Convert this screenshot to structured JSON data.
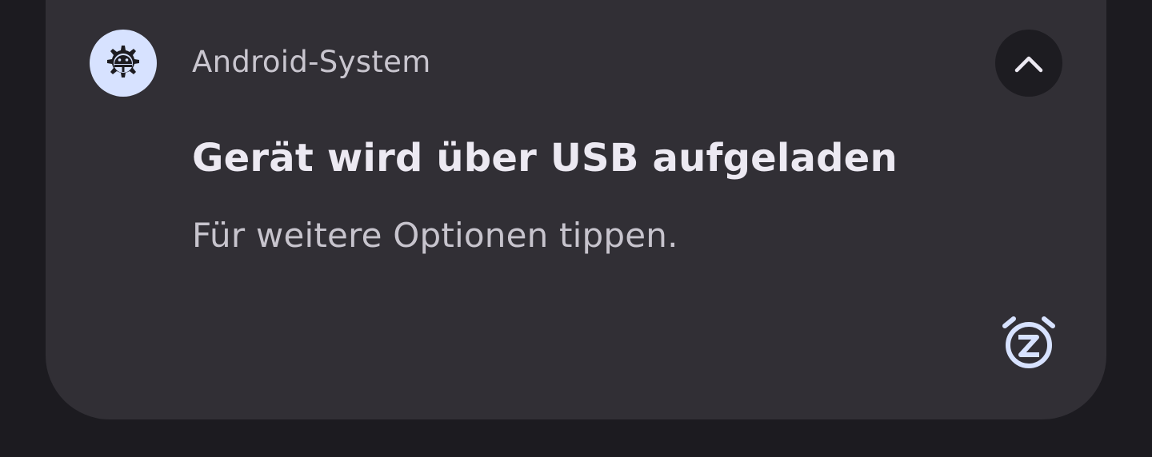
{
  "notification": {
    "app_name": "Android-System",
    "title": "Gerät wird über USB aufgeladen",
    "text": "Für weitere Optionen tippen.",
    "app_icon": "android-system-gear-icon",
    "expand_icon": "chevron-up-icon",
    "snooze_icon": "snooze-alarm-icon"
  },
  "colors": {
    "background": "#1c1b20",
    "card": "#312f35",
    "icon_circle": "#d7e2ff",
    "accent_icon": "#d7e2ff",
    "title_text": "#ece9f2",
    "secondary_text": "#c7c4cd",
    "expand_button_bg": "#1d1c21"
  }
}
